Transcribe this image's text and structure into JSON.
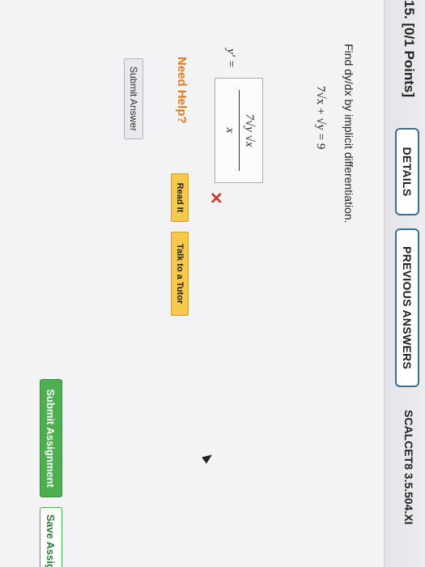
{
  "question": {
    "number_label": "15. [0/1 Points]",
    "details_label": "DETAILS",
    "previous_answers_label": "PREVIOUS ANSWERS",
    "course_code": "SCALCET8 3.5.504.XI"
  },
  "problem": {
    "prompt": "Find dy/dx by implicit differentiation.",
    "equation": "7√x + √y = 9",
    "answer_label": "y' =",
    "answer_numerator": "7√y √x",
    "answer_denominator": "x",
    "status_mark": "✕"
  },
  "help": {
    "label": "Need Help?",
    "read_it_label": "Read It",
    "tutor_label": "Talk to a Tutor"
  },
  "actions": {
    "submit_answer_label": "Submit Answer",
    "submit_assignment_label": "Submit Assignment",
    "save_assignment_label": "Save Assig"
  },
  "colors": {
    "wrong": "#d0342c",
    "need_help": "#e07a1f",
    "help_button": "#f6c84b",
    "submit_green": "#4caf50",
    "header_button_border": "#3c6f8f"
  }
}
